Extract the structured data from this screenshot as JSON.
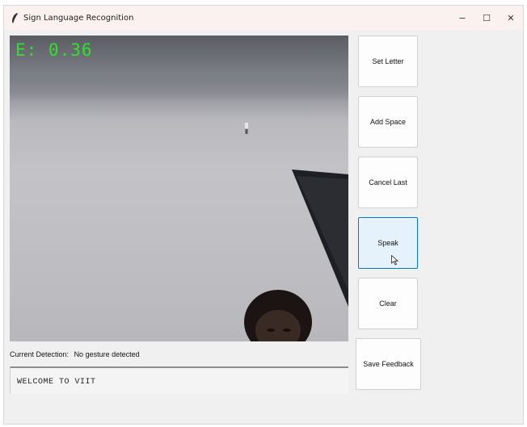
{
  "window": {
    "title": "Sign Language Recognition",
    "controls": {
      "minimize": "−",
      "maximize": "☐",
      "close": "✕"
    }
  },
  "camera": {
    "overlay_label": "E: 0.36",
    "overlay_color": "#2fe02f"
  },
  "detection": {
    "label": "Current Detection:",
    "value": "No gesture detected"
  },
  "output": {
    "text": "WELCOME TO VIIT"
  },
  "buttons": {
    "set_letter": "Set Letter",
    "add_space": "Add Space",
    "cancel_last": "Cancel Last",
    "speak": "Speak",
    "clear": "Clear",
    "save_feedback": "Save Feedback"
  },
  "colors": {
    "active_button_border": "#0078d7",
    "active_button_fill": "#e5f1fb"
  }
}
